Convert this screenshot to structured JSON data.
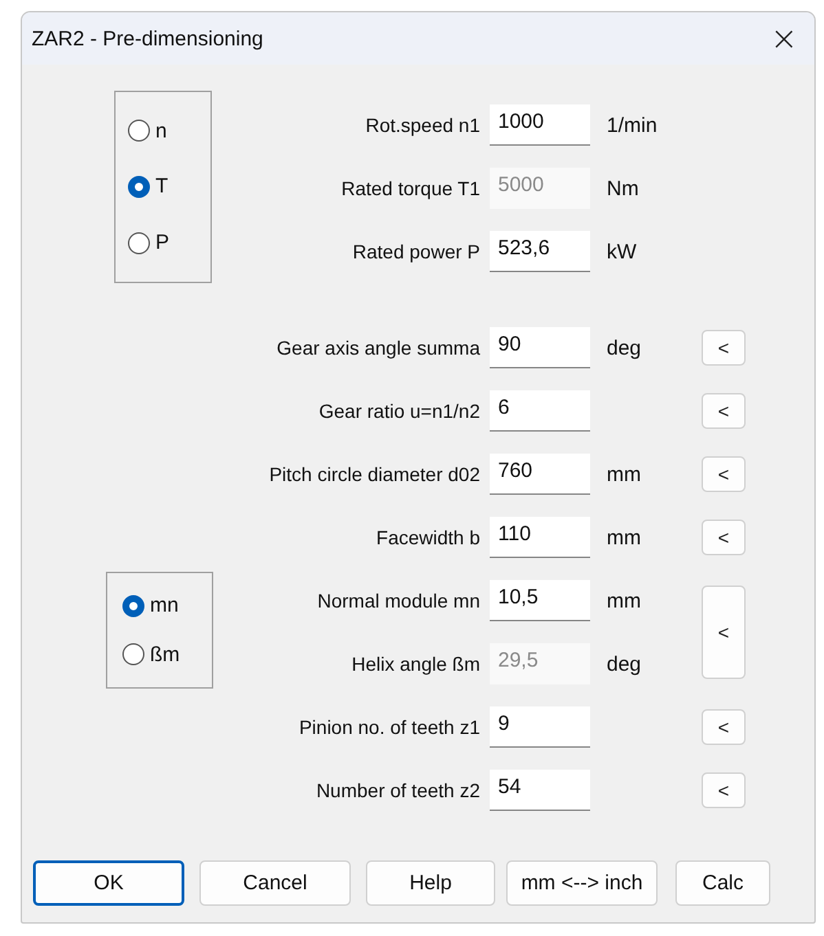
{
  "window": {
    "title": "ZAR2 - Pre-dimensioning",
    "close": "×"
  },
  "mode_groups": [
    {
      "options": [
        {
          "label": "n",
          "selected": false
        },
        {
          "label": "T",
          "selected": true
        },
        {
          "label": "P",
          "selected": false
        }
      ]
    },
    {
      "options": [
        {
          "label": "mn",
          "selected": true
        },
        {
          "label": "ßm",
          "selected": false
        }
      ]
    }
  ],
  "rows": [
    {
      "label": "Rot.speed n1",
      "value": "1000",
      "unit": "1/min",
      "disabled": false
    },
    {
      "label": "Rated torque T1",
      "value": "5000",
      "unit": "Nm",
      "disabled": true
    },
    {
      "label": "Rated power P",
      "value": "523,6",
      "unit": "kW",
      "disabled": false
    },
    {
      "label": "Gear axis angle summa",
      "value": "90",
      "unit": "deg",
      "disabled": false,
      "button": {
        "label": "<",
        "spans_next": false
      }
    },
    {
      "label": "Gear ratio u=n1/n2",
      "value": "6",
      "disabled": false,
      "button": {
        "label": "<",
        "spans_next": false
      }
    },
    {
      "label": "Pitch circle diameter d02",
      "value": "760",
      "unit": "mm",
      "disabled": false,
      "button": {
        "label": "<",
        "spans_next": false
      }
    },
    {
      "label": "Facewidth b",
      "value": "110",
      "unit": "mm",
      "disabled": false,
      "button": {
        "label": "<",
        "spans_next": false
      }
    },
    {
      "label": "Normal module mn",
      "value": "10,5",
      "unit": "mm",
      "disabled": false,
      "button": {
        "label": "<",
        "spans_next": true
      }
    },
    {
      "label": "Helix angle ßm",
      "value": "29,5",
      "unit": "deg",
      "disabled": true
    },
    {
      "label": "Pinion no. of teeth z1",
      "value": "9",
      "disabled": false,
      "button": {
        "label": "<",
        "spans_next": false
      }
    },
    {
      "label": "Number of teeth z2",
      "value": "54",
      "disabled": false,
      "button": {
        "label": "<",
        "spans_next": false
      }
    }
  ],
  "buttons": [
    {
      "label": "OK",
      "default": true
    },
    {
      "label": "Cancel",
      "default": false
    },
    {
      "label": "Help",
      "default": false
    },
    {
      "label": "mm <--> inch",
      "default": false
    },
    {
      "label": "Calc",
      "default": false
    }
  ]
}
